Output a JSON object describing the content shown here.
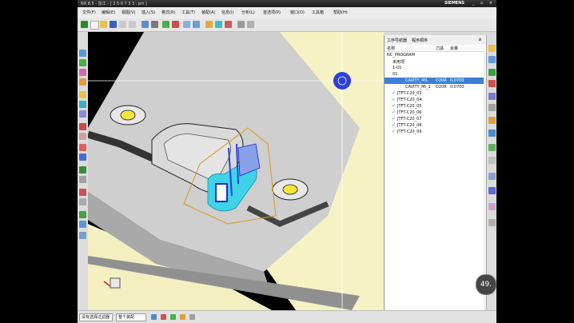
{
  "window": {
    "title": "NX 8.5 - 加工 - [ 2 5 0 7 3 3 . prt ]",
    "brand": "SIEMENS",
    "controls": "_ ▫ ×"
  },
  "menu": {
    "items": [
      "文件(F)",
      "编辑(E)",
      "视图(V)",
      "插入(S)",
      "格式(R)",
      "工具(T)",
      "装配(A)",
      "信息(I)",
      "分析(L)",
      "首选项(P)",
      "窗口(O)",
      "工具箱",
      "帮助(H)"
    ]
  },
  "navigator": {
    "tab_program": "工序导航器",
    "tab_order": "程序顺序",
    "pin": "ǿ",
    "columns": {
      "name": "名称",
      "tool": "刀具",
      "method": "余量"
    },
    "rows": [
      {
        "label": "NC_PROGRAM",
        "indent": 0,
        "check": false
      },
      {
        "label": "未用项",
        "indent": 1,
        "check": false
      },
      {
        "label": "1-01",
        "indent": 1,
        "check": false
      },
      {
        "label": "01",
        "indent": 1,
        "check": false
      },
      {
        "label": "CAVITY_MIL",
        "indent": 2,
        "check": false,
        "selected": true,
        "tool": "D20R",
        "method": "0.0700"
      },
      {
        "label": "CAVITY_MI_1",
        "indent": 2,
        "check": false,
        "tool": "D20R",
        "method": "0.0700"
      },
      {
        "label": "JTFT-C20_03",
        "indent": 1,
        "check": true
      },
      {
        "label": "JTFT-C20_04",
        "indent": 1,
        "check": true
      },
      {
        "label": "JTFT-C20_05",
        "indent": 1,
        "check": true
      },
      {
        "label": "JTFT-C20_06",
        "indent": 1,
        "check": true
      },
      {
        "label": "JTFT-C20_07",
        "indent": 1,
        "check": true
      },
      {
        "label": "JTFT-C20_08",
        "indent": 1,
        "check": true
      },
      {
        "label": "JTFT-C20_09",
        "indent": 1,
        "check": true
      }
    ]
  },
  "status": {
    "filter": "整个装配",
    "selection": "没有选择过滤器"
  },
  "badge": "49.",
  "colors": {
    "accent_blue": "#2d3fe0",
    "selection": "#3d7fd6",
    "part_gray": "#c8c8c8",
    "stock_yellow": "#f6f2c4",
    "toolpath_cyan": "#3fd3e8"
  }
}
